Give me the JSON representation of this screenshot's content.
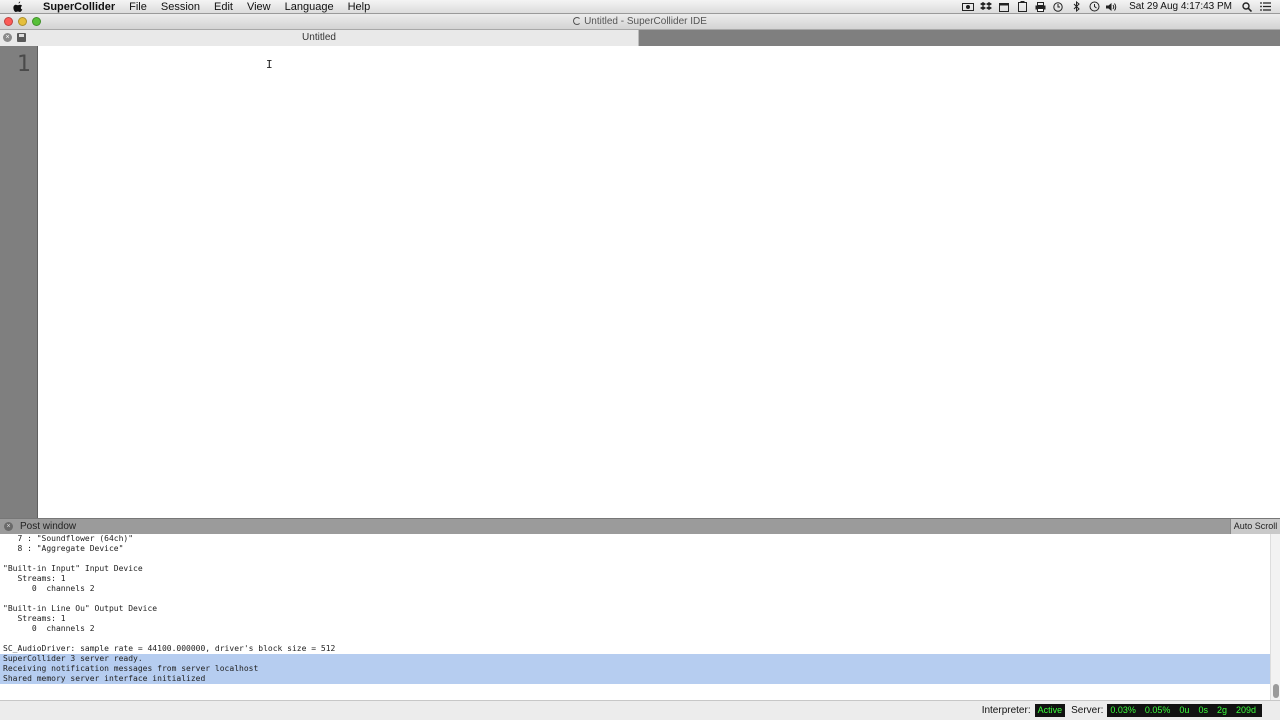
{
  "menubar": {
    "app": "SuperCollider",
    "items": [
      "File",
      "Session",
      "Edit",
      "View",
      "Language",
      "Help"
    ],
    "extras": [
      "camera-icon",
      "dropbox-icon",
      "calendar-icon",
      "clipboard-icon",
      "printer-icon",
      "timer-icon",
      "bluetooth-icon",
      "time-machine-icon",
      "volume-icon"
    ],
    "clock": "Sat 29 Aug  4:17:43 PM"
  },
  "window": {
    "title": "Untitled - SuperCollider IDE"
  },
  "tab": {
    "title": "Untitled"
  },
  "editor": {
    "line_number": "1",
    "cursor": "I"
  },
  "post_window": {
    "title": "Post window",
    "auto_scroll": "Auto Scroll",
    "lines": [
      "   7 : \"Soundflower (64ch)\"",
      "   8 : \"Aggregate Device\"",
      "",
      "\"Built-in Input\" Input Device",
      "   Streams: 1",
      "      0  channels 2",
      "",
      "\"Built-in Line Ou\" Output Device",
      "   Streams: 1",
      "      0  channels 2",
      "",
      "SC_AudioDriver: sample rate = 44100.000000, driver's block size = 512",
      "SuperCollider 3 server ready.",
      "Receiving notification messages from server localhost",
      "Shared memory server interface initialized"
    ],
    "highlighted_from": 12
  },
  "status": {
    "interpreter_label": "Interpreter:",
    "interpreter_state": "Active",
    "server_label": "Server:",
    "server_stats": [
      "0.03%",
      "0.05%",
      "0u",
      "0s",
      "2g",
      "209d"
    ]
  },
  "colors": {
    "status_green": "#3cff3c",
    "selection": "#b6cdf0",
    "gutter": "#7f7f7f"
  }
}
